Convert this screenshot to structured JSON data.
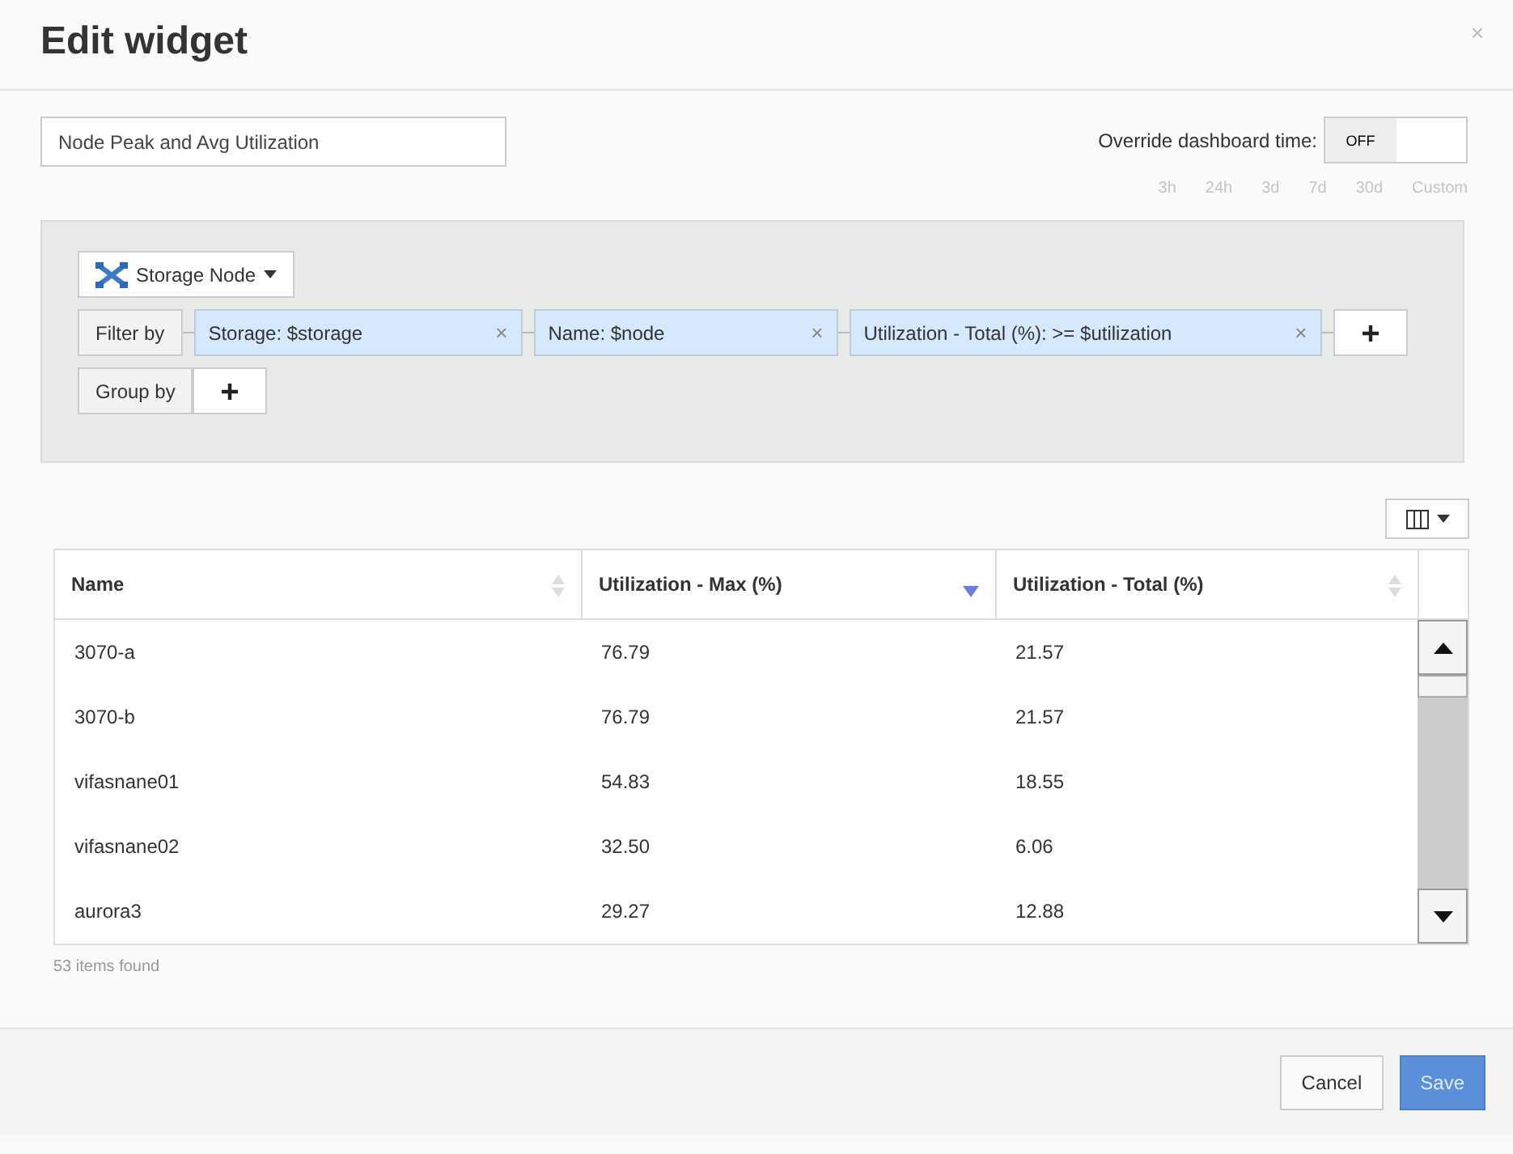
{
  "dialog": {
    "title": "Edit widget",
    "close": "×"
  },
  "name_field": {
    "value": "Node Peak and Avg Utilization"
  },
  "override": {
    "label": "Override dashboard time:",
    "state_label": "OFF",
    "on": false
  },
  "time_ranges": [
    {
      "label": "3h",
      "disabled": true
    },
    {
      "label": "24h",
      "disabled": true
    },
    {
      "label": "3d",
      "disabled": true
    },
    {
      "label": "7d",
      "disabled": true
    },
    {
      "label": "30d",
      "disabled": true
    },
    {
      "label": "Custom",
      "disabled": true
    }
  ],
  "query": {
    "object_type": "Storage Node",
    "filter_label": "Filter by",
    "filters": [
      {
        "label": "Storage: $storage",
        "remove": "×"
      },
      {
        "label": "Name: $node",
        "remove": "×"
      },
      {
        "label": "Utilization - Total (%): >= $utilization",
        "remove": "×"
      }
    ],
    "group_label": "Group by"
  },
  "table": {
    "columns": [
      {
        "label": "Name",
        "sorted": false
      },
      {
        "label": "Utilization - Max (%)",
        "sorted": true
      },
      {
        "label": "Utilization - Total (%)",
        "sorted": false
      }
    ],
    "rows": [
      [
        "3070-a",
        "76.79",
        "21.57"
      ],
      [
        "3070-b",
        "76.79",
        "21.57"
      ],
      [
        "vifasnane01",
        "54.83",
        "18.55"
      ],
      [
        "vifasnane02",
        "32.50",
        "6.06"
      ],
      [
        "aurora3",
        "29.27",
        "12.88"
      ]
    ],
    "status": "53 items found"
  },
  "buttons": [
    {
      "label": "Cancel",
      "kind": "default"
    },
    {
      "label": "Save",
      "kind": "primary"
    }
  ]
}
